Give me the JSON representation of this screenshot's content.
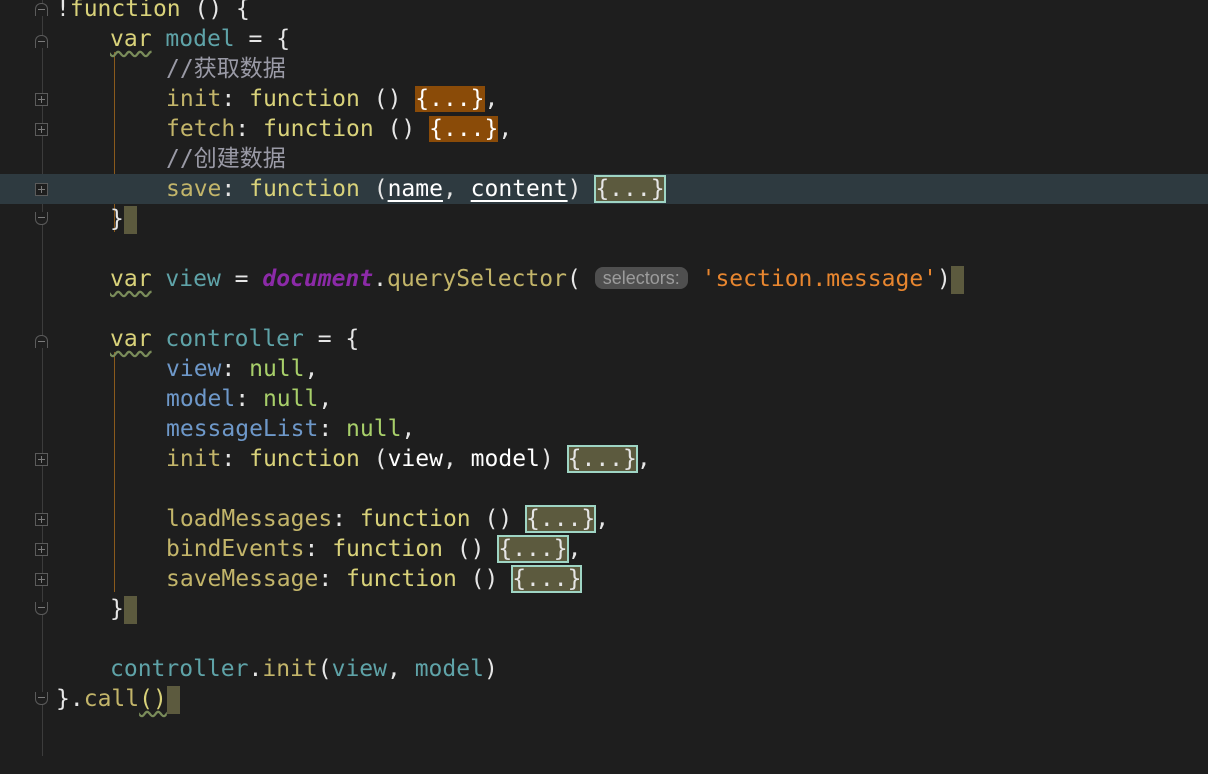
{
  "editor": {
    "lines": {
      "l0": {
        "bang": "!",
        "function": "function",
        "rest": " () {"
      },
      "l1": {
        "var": "var",
        "name": "model",
        "rest": " = {"
      },
      "l2": {
        "comment": "//获取数据"
      },
      "l3": {
        "prop": "init",
        "colon": ": ",
        "function": "function",
        "paren": " () ",
        "folded": "{...}",
        "tail": ","
      },
      "l4": {
        "prop": "fetch",
        "colon": ": ",
        "function": "function",
        "paren": " () ",
        "folded": "{...}",
        "tail": ","
      },
      "l5": {
        "comment": "//创建数据"
      },
      "l6": {
        "prop": "save",
        "colon": ": ",
        "function": "function",
        "open": " (",
        "p1": "name",
        "comma": ", ",
        "p2": "content",
        "close": ") ",
        "folded": "{...}"
      },
      "l7": {
        "brace": "}"
      },
      "l9": {
        "var": "var",
        "name": "view",
        "eq": " = ",
        "doc": "document",
        "dot": ".",
        "method": "querySelector",
        "open": "(",
        "hint": "selectors:",
        "str": "'section.message'",
        "close": ")"
      },
      "l11": {
        "var": "var",
        "name": "controller",
        "rest": " = {"
      },
      "l12": {
        "prop": "view",
        "colon": ": ",
        "value": "null",
        "tail": ","
      },
      "l13": {
        "prop": "model",
        "colon": ": ",
        "value": "null",
        "tail": ","
      },
      "l14": {
        "prop": "messageList",
        "colon": ": ",
        "value": "null",
        "tail": ","
      },
      "l15": {
        "prop": "init",
        "colon": ": ",
        "function": "function",
        "open": " (",
        "p1": "view",
        "comma": ", ",
        "p2": "model",
        "close": ") ",
        "folded": "{...}",
        "tail": ","
      },
      "l17": {
        "prop": "loadMessages",
        "colon": ": ",
        "function": "function",
        "paren": " () ",
        "folded": "{...}",
        "tail": ","
      },
      "l18": {
        "prop": "bindEvents",
        "colon": ": ",
        "function": "function",
        "paren": " () ",
        "folded": "{...}",
        "tail": ","
      },
      "l19": {
        "prop": "saveMessage",
        "colon": ": ",
        "function": "function",
        "paren": " () ",
        "folded": "{...}"
      },
      "l20": {
        "brace": "}"
      },
      "l22": {
        "obj": "controller",
        "dot": ".",
        "method": "init",
        "open": "(",
        "a1": "view",
        "comma": ", ",
        "a2": "model",
        "close": ")"
      },
      "l23": {
        "brace": "}",
        "dot": ".",
        "method": "call",
        "parens": "()"
      }
    }
  },
  "colors": {
    "background": "#1e1e1e",
    "current_line": "#2e3a40",
    "keyword": "#d9d27a",
    "string": "#e8862f",
    "folded_orange": "#8a4b08",
    "folded_teal_border": "#9fd5c4"
  }
}
